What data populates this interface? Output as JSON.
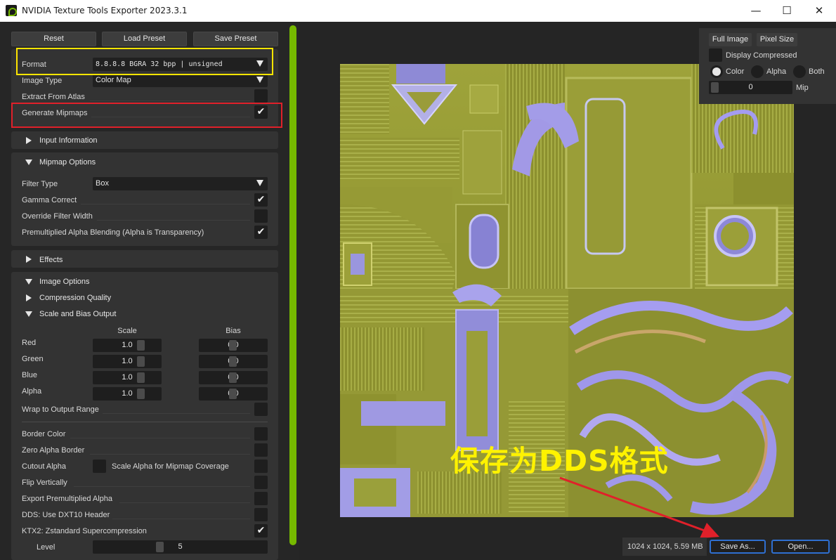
{
  "window": {
    "title": "NVIDIA Texture Tools Exporter 2023.3.1"
  },
  "window_controls": {
    "minimize": "—",
    "maximize": "☐",
    "close": "✕"
  },
  "toolbar": {
    "reset": "Reset",
    "load_preset": "Load Preset",
    "save_preset": "Save Preset"
  },
  "format": {
    "label": "Format",
    "value": "8.8.8.8  BGRA  32 bpp | unsigned"
  },
  "image_type": {
    "label": "Image Type",
    "value": "Color Map"
  },
  "extract_from_atlas": {
    "label": "Extract From Atlas",
    "checked": false
  },
  "generate_mipmaps": {
    "label": "Generate Mipmaps",
    "checked": true
  },
  "sections": {
    "input_information": "Input Information",
    "mipmap_options": "Mipmap Options",
    "effects": "Effects",
    "image_options": "Image Options",
    "compression_quality": "Compression Quality",
    "scale_bias": "Scale and Bias Output"
  },
  "mipmap": {
    "filter_type_label": "Filter Type",
    "filter_type_value": "Box",
    "gamma_correct": "Gamma Correct",
    "override_filter_width": "Override Filter Width",
    "premultiplied": "Premultiplied Alpha Blending (Alpha is Transparency)"
  },
  "scale_bias": {
    "scale_header": "Scale",
    "bias_header": "Bias",
    "channels": [
      {
        "name": "Red",
        "scale": "1.0",
        "bias": "0.0"
      },
      {
        "name": "Green",
        "scale": "1.0",
        "bias": "0.0"
      },
      {
        "name": "Blue",
        "scale": "1.0",
        "bias": "0.0"
      },
      {
        "name": "Alpha",
        "scale": "1.0",
        "bias": "0.0"
      }
    ],
    "wrap": "Wrap to Output Range"
  },
  "options": {
    "border_color": "Border Color",
    "zero_alpha_border": "Zero Alpha Border",
    "cutout_alpha": "Cutout Alpha",
    "scale_alpha_mip": "Scale Alpha for Mipmap Coverage",
    "flip_vertically": "Flip Vertically",
    "export_premultiplied": "Export Premultiplied Alpha",
    "dds_dxt10": "DDS: Use DXT10 Header",
    "ktx2_zstd": "KTX2: Zstandard Supercompression",
    "level_label": "Level",
    "level_value": "5",
    "level_fraction": 0.38
  },
  "viewer": {
    "full_image": "Full Image",
    "pixel_size": "Pixel Size",
    "display_compressed": "Display Compressed",
    "color": "Color",
    "alpha": "Alpha",
    "both": "Both",
    "mip_value": "0",
    "mip_label": "Mip",
    "selected_channel": "Color"
  },
  "status": {
    "info": "1024 x 1024, 5.59 MB"
  },
  "actions": {
    "save_as": "Save As...",
    "open": "Open..."
  },
  "annotation": {
    "text": "保存为DDS格式"
  },
  "colors": {
    "accent": "#76b900",
    "highlight_yellow": "#ffe500",
    "highlight_red": "#e0202a",
    "arrow_red": "#e0202a",
    "button_border": "#2f6fd0",
    "annotation_text": "#fff200"
  }
}
